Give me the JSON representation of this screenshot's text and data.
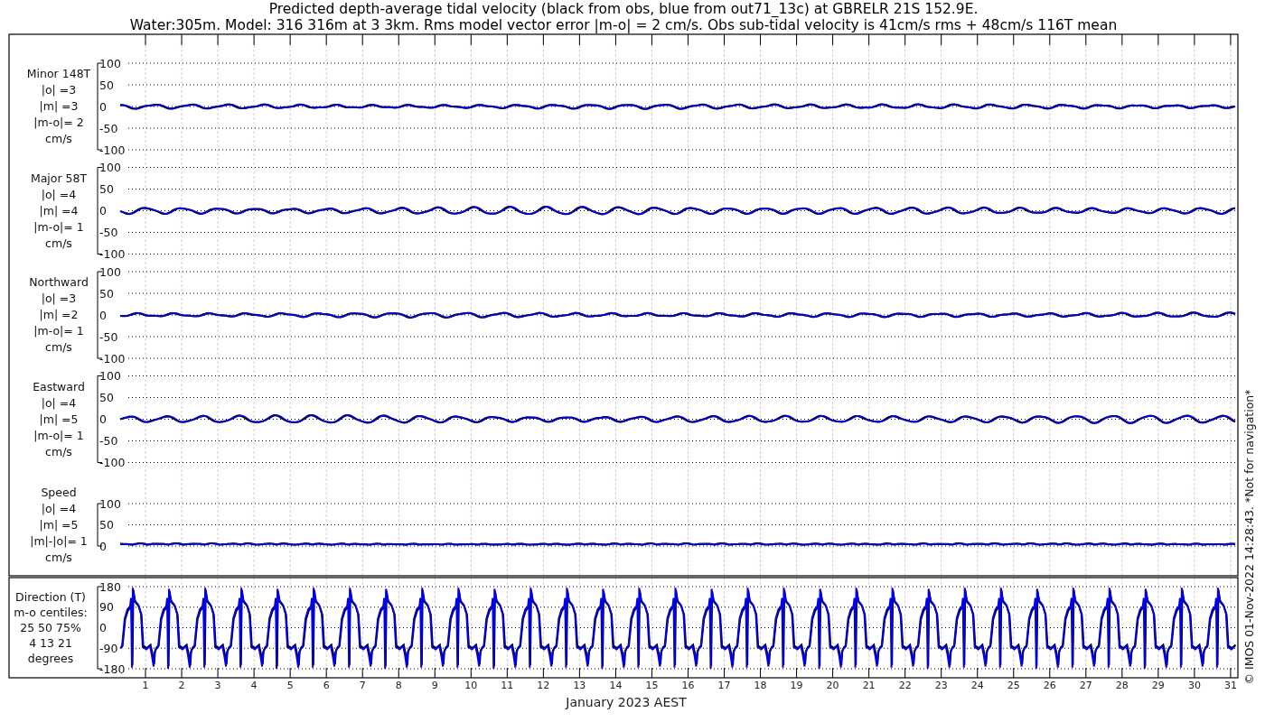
{
  "title": [
    "Predicted depth-average tidal velocity (black from obs, blue from out71_13c) at GBRELR 21S 152.9E.",
    "Water:305m. Model: 316 316m at 3 3km. Rms model vector error |m-o| = 2 cm/s. Obs sub-tidal velocity is 41cm/s rms + 48cm/s 116T mean"
  ],
  "panels": [
    {
      "kind": "velocity",
      "label_lines": [
        "Minor 148T",
        "|o| =3",
        "|m| =3",
        "|m-o|= 2",
        "cm/s"
      ],
      "yticks": [
        "100",
        "50",
        "0",
        "-50",
        "-100"
      ]
    },
    {
      "kind": "velocity",
      "label_lines": [
        "Major 58T",
        "|o| =4",
        "|m| =4",
        "|m-o|= 1",
        "cm/s"
      ],
      "yticks": [
        "100",
        "50",
        "0",
        "-50",
        "-100"
      ]
    },
    {
      "kind": "velocity",
      "label_lines": [
        "Northward",
        "|o| =3",
        "|m| =2",
        "|m-o|= 1",
        "cm/s"
      ],
      "yticks": [
        "100",
        "50",
        "0",
        "-50",
        "-100"
      ]
    },
    {
      "kind": "velocity",
      "label_lines": [
        "Eastward",
        "|o| =4",
        "|m| =5",
        "|m-o|= 1",
        "cm/s"
      ],
      "yticks": [
        "100",
        "50",
        "0",
        "-50",
        "-100"
      ]
    },
    {
      "kind": "speed",
      "label_lines": [
        "Speed",
        "|o| =4",
        "|m| =5",
        "|m|-|o|= 1",
        "cm/s"
      ],
      "yticks": [
        "100",
        "50",
        "0"
      ]
    },
    {
      "kind": "direction",
      "label_lines": [
        "Direction (T)",
        "m-o centiles:",
        "25  50  75%",
        "4  13  21",
        "degrees"
      ],
      "yticks": [
        "180",
        "90",
        "0",
        "-90",
        "-180"
      ]
    }
  ],
  "x_ticks": [
    "1",
    "2",
    "3",
    "4",
    "5",
    "6",
    "7",
    "8",
    "9",
    "10",
    "11",
    "12",
    "13",
    "14",
    "15",
    "16",
    "17",
    "18",
    "19",
    "20",
    "21",
    "22",
    "23",
    "24",
    "25",
    "26",
    "27",
    "28",
    "29",
    "30",
    "31"
  ],
  "xlabel": "January 2023 AEST",
  "credit": "© IMOS 01-Nov-2022 14:28:43. *Not for navigation*"
}
